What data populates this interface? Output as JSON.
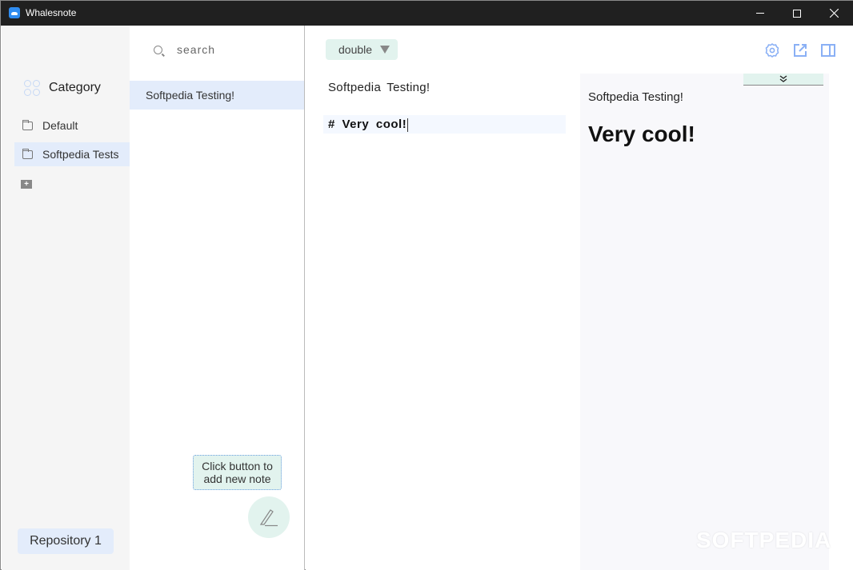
{
  "window": {
    "title": "Whalesnote",
    "controls": {
      "minimize": "minimize",
      "maximize": "maximize",
      "close": "close"
    }
  },
  "sidebar": {
    "header": "Category",
    "categories": [
      {
        "label": "Default",
        "active": false
      },
      {
        "label": "Softpedia Tests",
        "active": true
      }
    ],
    "repository_button": "Repository 1"
  },
  "notes": {
    "search_placeholder": "search",
    "search_value": "",
    "items": [
      {
        "title": "Softpedia Testing!",
        "active": true
      }
    ],
    "tip": "Click button to add new note"
  },
  "toolbar": {
    "mode_select": "double",
    "icons": [
      "gear-icon",
      "external-link-icon",
      "split-view-icon"
    ],
    "accent_color": "#8ab0f5"
  },
  "editor": {
    "lines": [
      "Softpedia  Testing!",
      "#  Very  cool!"
    ]
  },
  "preview": {
    "paragraph": "Softpedia Testing!",
    "heading": "Very cool!"
  },
  "watermark": "SOFTPEDIA"
}
